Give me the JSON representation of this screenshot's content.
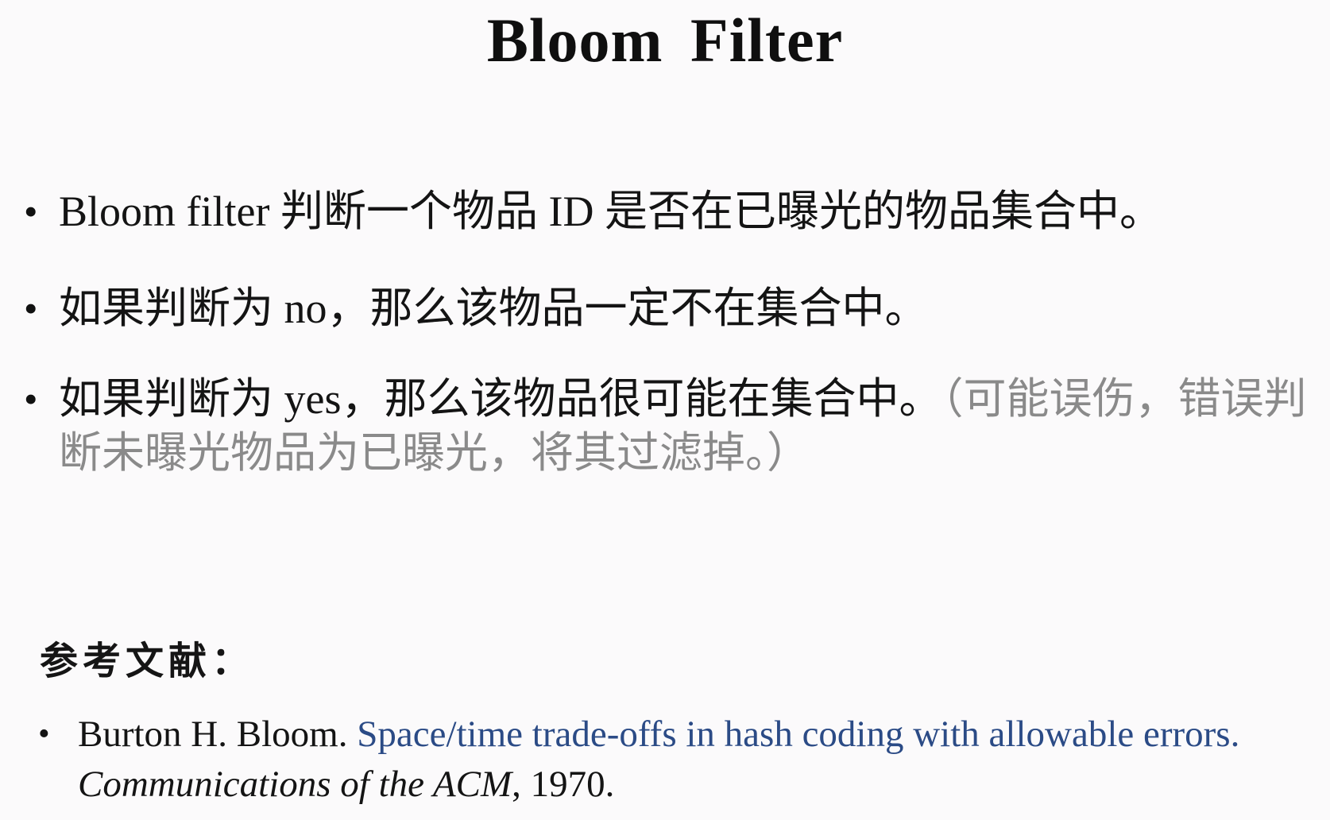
{
  "title": "Bloom  Filter",
  "bullets": [
    {
      "dot": "•",
      "text": "Bloom filter 判断一个物品 ID 是否在已曝光的物品集合中。"
    },
    {
      "dot": "•",
      "text": "如果判断为 no，那么该物品一定不在集合中。"
    },
    {
      "dot": "•",
      "text": "如果判断为 yes，那么该物品很可能在集合中。",
      "note": "（可能误伤，错误判断未曝光物品为已曝光，将其过滤掉。）"
    }
  ],
  "references": {
    "heading": "参考文献：",
    "items": [
      {
        "dot": "•",
        "author": "Burton H. Bloom. ",
        "title": "Space/time trade-offs in hash coding with allowable errors.",
        "venue": " Communications of the ACM",
        "year": ", 1970."
      }
    ]
  },
  "colors": {
    "background": "#fbfafb",
    "text": "#141414",
    "note_gray": "#8a8a8a",
    "link_blue": "#2b4b86"
  }
}
